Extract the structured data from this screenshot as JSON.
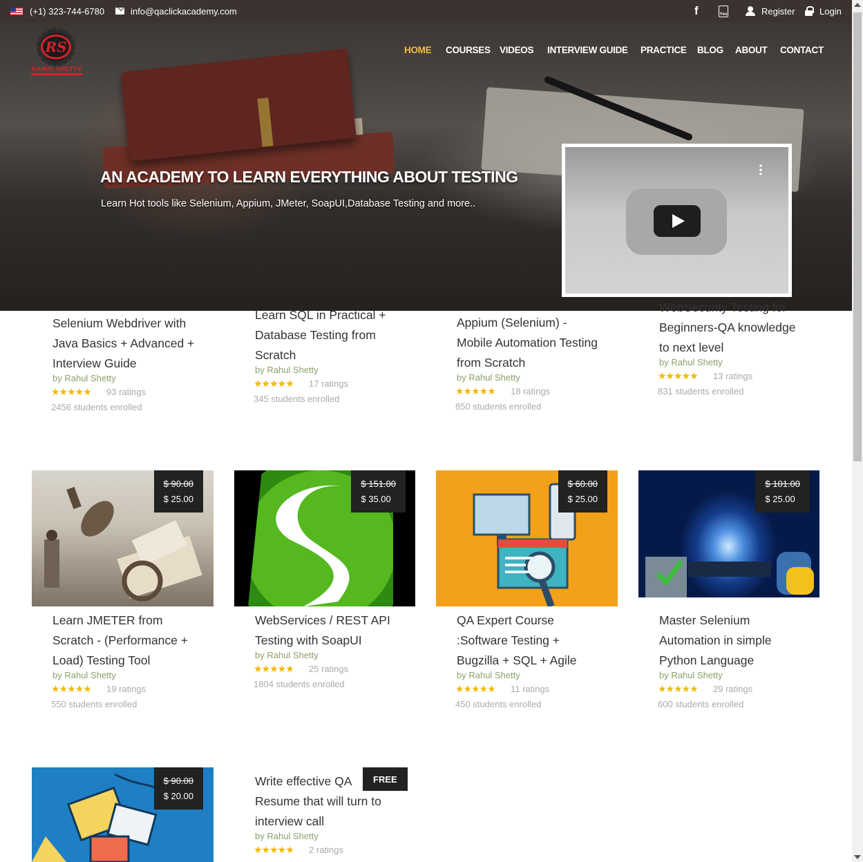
{
  "topbar": {
    "phone": "(+1) 323-744-6780",
    "email": "info@qaclickacademy.com",
    "register": "Register",
    "login": "Login"
  },
  "logo": {
    "name": "RAHUL SHETTY",
    "monogram": "RS"
  },
  "nav": [
    "HOME",
    "COURSES",
    "VIDEOS",
    "INTERVIEW GUIDE",
    "PRACTICE",
    "BLOG",
    "ABOUT",
    "CONTACT"
  ],
  "hero": {
    "title": "AN ACADEMY TO LEARN EVERYTHING ABOUT TESTING",
    "subtitle": "Learn Hot tools like Selenium, Appium, JMeter, SoapUI,Database Testing and more.."
  },
  "colors": {
    "accent": "#f1bd44",
    "author": "#8aa06a",
    "stars": "#f2b707",
    "topbar": "#3a3330"
  },
  "courses_row1": [
    {
      "title_lines": [
        "Selenium Webdriver with",
        "Java Basics + Advanced +",
        "Interview Guide"
      ],
      "author": "by Rahul Shetty",
      "ratings": "93 ratings",
      "enrolled": "2456 students enrolled"
    },
    {
      "title_lines": [
        "Learn SQL in Practical +",
        "Database Testing from",
        "Scratch"
      ],
      "author": "by Rahul Shetty",
      "ratings": "17 ratings",
      "enrolled": "345 students enrolled"
    },
    {
      "title_lines": [
        "Appium (Selenium) -",
        "Mobile Automation Testing",
        "from Scratch"
      ],
      "author": "by Rahul Shetty",
      "ratings": "18 ratings",
      "enrolled": "850 students enrolled"
    },
    {
      "title_lines": [
        "WebSecurity Testing for",
        "Beginners-QA knowledge",
        "to next level"
      ],
      "author": "by Rahul Shetty",
      "ratings": "13 ratings",
      "enrolled": "831 students enrolled"
    }
  ],
  "courses_row2": [
    {
      "old_price": "$ 90.00",
      "price": "$ 25.00",
      "title_lines": [
        "Learn JMETER from",
        "Scratch - (Performance +",
        "Load) Testing Tool"
      ],
      "author": "by Rahul Shetty",
      "ratings": "19 ratings",
      "enrolled": "550 students enrolled"
    },
    {
      "old_price": "$ 151.00",
      "price": "$ 35.00",
      "title_lines": [
        "WebServices / REST API",
        "Testing with SoapUI"
      ],
      "author": "by Rahul Shetty",
      "ratings": "25 ratings",
      "enrolled": "1804 students enrolled"
    },
    {
      "old_price": "$ 60.00",
      "price": "$ 25.00",
      "title_lines": [
        "QA Expert Course",
        ":Software Testing +",
        "Bugzilla + SQL + Agile"
      ],
      "author": "by Rahul Shetty",
      "ratings": "11 ratings",
      "enrolled": "450 students enrolled"
    },
    {
      "old_price": "$ 101.00",
      "price": "$ 25.00",
      "title_lines": [
        "Master Selenium",
        "Automation in simple",
        "Python Language"
      ],
      "author": "by Rahul Shetty",
      "ratings": "29 ratings",
      "enrolled": "600 students enrolled"
    }
  ],
  "courses_row3": [
    {
      "old_price": "$ 90.00",
      "price": "$ 20.00"
    },
    {
      "badge": "FREE",
      "title_lines": [
        "Write effective QA",
        "Resume that will turn to",
        "interview call"
      ],
      "author": "by Rahul Shetty",
      "ratings": "2 ratings"
    }
  ],
  "stars": "★★★★★"
}
